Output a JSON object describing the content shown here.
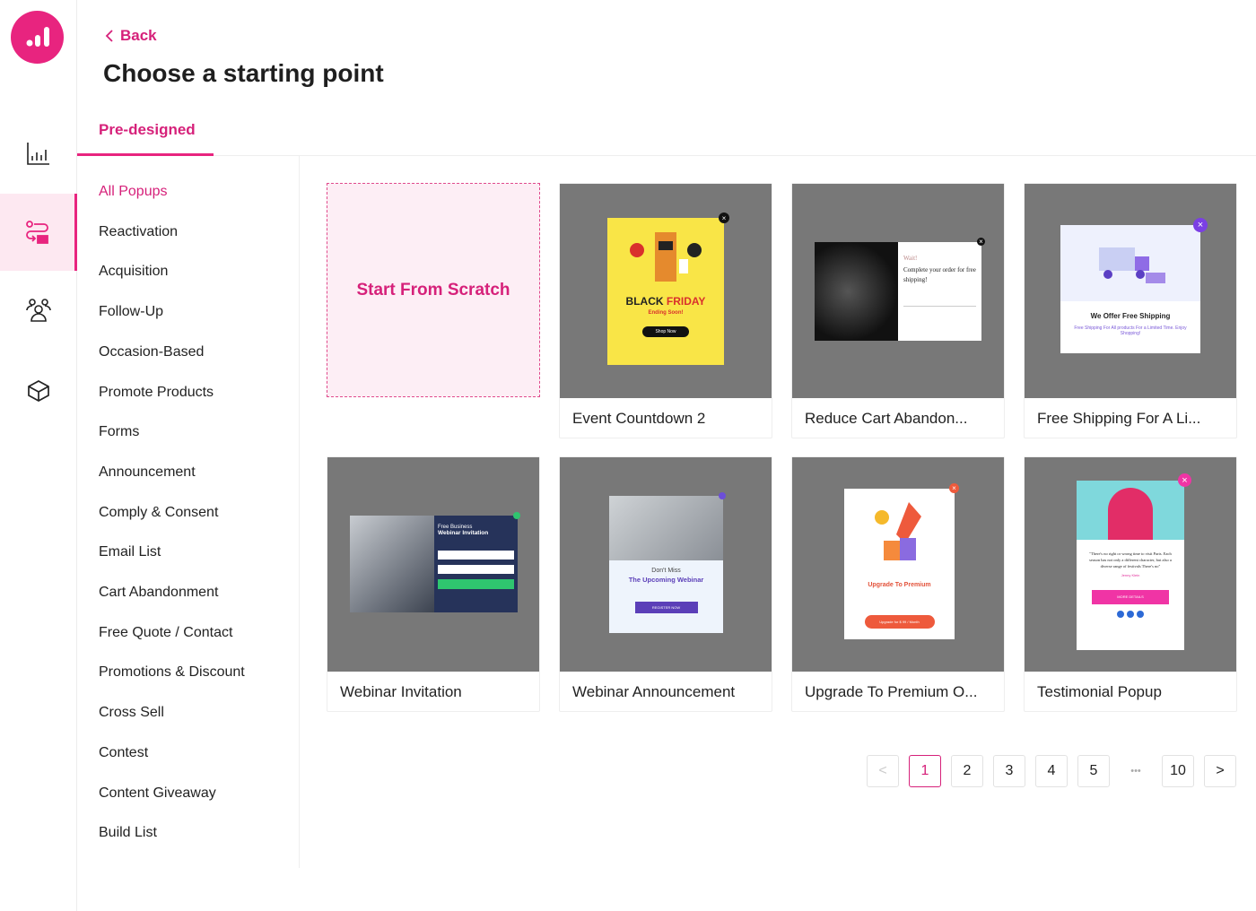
{
  "nav": {
    "back_label": "Back",
    "items": [
      {
        "icon": "analytics-icon"
      },
      {
        "icon": "campaign-flow-icon",
        "active": true
      },
      {
        "icon": "audience-icon"
      },
      {
        "icon": "box-icon"
      }
    ]
  },
  "page": {
    "title": "Choose a starting point"
  },
  "tabs": [
    {
      "label": "Pre-designed",
      "active": true
    }
  ],
  "categories": [
    "All Popups",
    "Reactivation",
    "Acquisition",
    "Follow-Up",
    "Occasion-Based",
    "Promote Products",
    "Forms",
    "Announcement",
    "Comply & Consent",
    "Email List",
    "Cart Abandonment",
    "Free Quote / Contact",
    "Promotions & Discount",
    "Cross Sell",
    "Contest",
    "Content Giveaway",
    "Build List"
  ],
  "active_category": "All Popups",
  "scratch_label": "Start From Scratch",
  "templates": [
    {
      "name": "Event Countdown 2",
      "t1": "BLACK",
      "t2": "FRIDAY",
      "t3": "Ending Soon!",
      "btn": "Shop Now"
    },
    {
      "name": "Reduce Cart Abandon...",
      "t1": "Wait!",
      "t2": "Complete your order for free shipping!"
    },
    {
      "name": "Free Shipping For A Li...",
      "t1": "We Offer Free Shipping",
      "t2": "Free Shipping For All products For a Limited Time. Enjoy Shopping!"
    },
    {
      "name": "Webinar Invitation",
      "t1": "Free Business",
      "t2": "Webinar Invitation"
    },
    {
      "name": "Webinar Announcement",
      "t1": "Don't Miss",
      "t2": "The Upcoming Webinar",
      "btn": "REGISTER NOW"
    },
    {
      "name": "Upgrade To Premium O...",
      "t1": "Upgrade To Premium",
      "btn": "Upgrade for $ 99 / Month"
    },
    {
      "name": "Testimonial Popup",
      "t1": "\"There's no right or wrong time to visit Paris. Each season has not only a different character, but also a diverse range of festivals There's no\"",
      "t2": "Jenny Klein",
      "btn": "MORE DETAILS"
    }
  ],
  "pagination": {
    "pages": [
      "1",
      "2",
      "3",
      "4",
      "5"
    ],
    "ellipsis": "•••",
    "last": "10",
    "current": "1",
    "prev": "<",
    "next": ">"
  },
  "colors": {
    "accent": "#e8247f",
    "thumb_bg": "#787878"
  }
}
